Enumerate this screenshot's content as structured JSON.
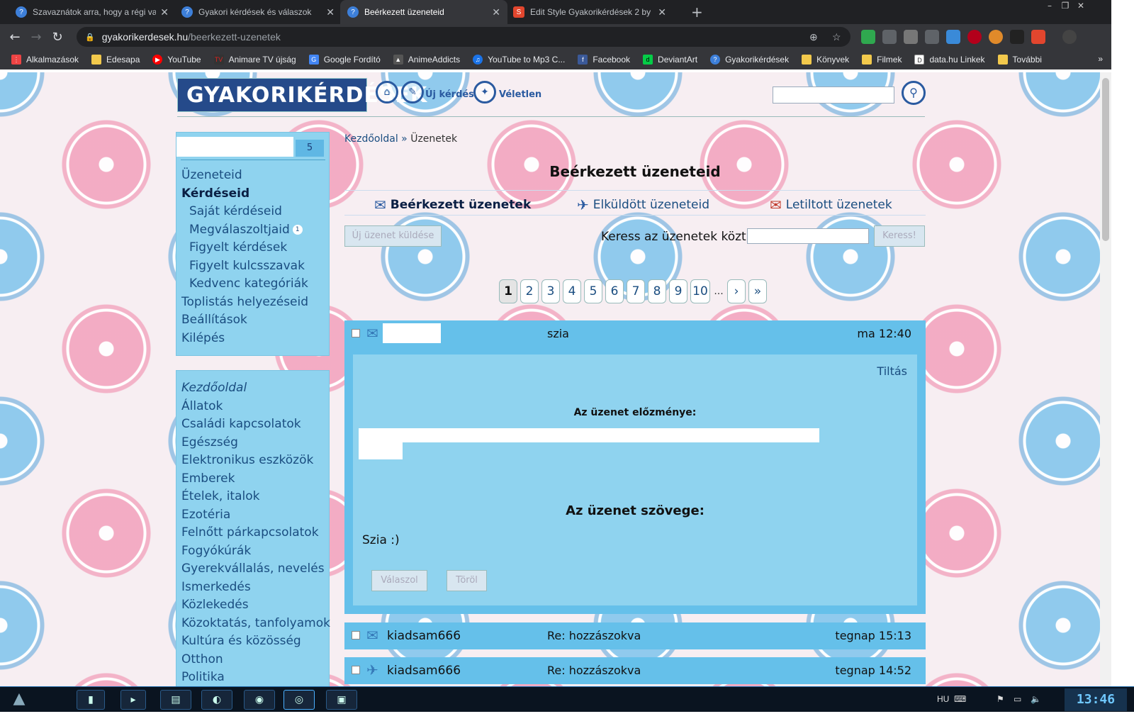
{
  "browser": {
    "tabs": [
      {
        "title": "Szavaznátok arra, hogy a régi va",
        "active": false
      },
      {
        "title": "Gyakori kérdések és válaszok",
        "active": false
      },
      {
        "title": "Beérkezett üzeneteid",
        "active": true
      },
      {
        "title": "Edit Style Gyakorikérdések 2 by",
        "active": false
      }
    ],
    "url_host": "gyakorikerdesek.hu",
    "url_path": "/beerkezett-uzenetek",
    "bookmarks": [
      "Alkalmazások",
      "Edesapa",
      "YouTube",
      "Animare TV újság",
      "Google Fordító",
      "AnimeAddicts",
      "YouTube to Mp3 C...",
      "Facebook",
      "DeviantArt",
      "Gyakorikérdések",
      "Könyvek",
      "Filmek",
      "data.hu Linkek",
      "További"
    ]
  },
  "site": {
    "logo": "GYAKORIKÉRDÉSEK",
    "new_question": "Új kérdés",
    "random": "Véletlen"
  },
  "sidebar": {
    "badge": "5",
    "menu": [
      {
        "label": "Üzeneteid",
        "style": ""
      },
      {
        "label": "Kérdéseid",
        "style": "bold"
      },
      {
        "label": "Saját kérdéseid",
        "style": "sub"
      },
      {
        "label": "Megválaszoltjaid",
        "style": "sub",
        "count": "1"
      },
      {
        "label": "Figyelt kérdések",
        "style": "sub"
      },
      {
        "label": "Figyelt kulcsszavak",
        "style": "sub"
      },
      {
        "label": "Kedvenc kategóriák",
        "style": "sub"
      },
      {
        "label": "Toplistás helyezéseid",
        "style": ""
      },
      {
        "label": "Beállítások",
        "style": ""
      },
      {
        "label": "Kilépés",
        "style": ""
      }
    ],
    "categories": [
      "Kezdőoldal",
      "Állatok",
      "Családi kapcsolatok",
      "Egészség",
      "Elektronikus eszközök",
      "Emberek",
      "Ételek, italok",
      "Ezotéria",
      "Felnőtt párkapcsolatok",
      "Fogyókúrák",
      "Gyerekvállalás, nevelés",
      "Ismerkedés",
      "Közlekedés",
      "Közoktatás, tanfolyamok",
      "Kultúra és közösség",
      "Otthon",
      "Politika"
    ]
  },
  "main": {
    "breadcrumb_home": "Kezdőoldal",
    "breadcrumb_sep": "»",
    "breadcrumb_current": "Üzenetek",
    "title": "Beérkezett üzeneteid",
    "tabs": [
      "Beérkezett üzenetek",
      "Elküldött üzeneteid",
      "Letiltott üzenetek"
    ],
    "new_message_btn": "Új üzenet küldése",
    "search_label": "Keress az üzenetek közt:",
    "search_btn": "Keress!",
    "pages": [
      "1",
      "2",
      "3",
      "4",
      "5",
      "6",
      "7",
      "8",
      "9",
      "10"
    ],
    "pages_dots": "...",
    "next": "›",
    "last": "»",
    "messages": [
      {
        "sender": "",
        "subject": "szia",
        "date": "ma 12:40",
        "expanded": true
      },
      {
        "sender": "kiadsam666",
        "subject": "Re: hozzászokva",
        "date": "tegnap 15:13",
        "expanded": false
      },
      {
        "sender": "kiadsam666",
        "subject": "Re: hozzászokva",
        "date": "tegnap 14:52",
        "expanded": false
      }
    ],
    "open_message": {
      "block": "Tiltás",
      "history_label": "Az üzenet előzménye:",
      "text_label": "Az üzenet szövege:",
      "text": "Szia :)",
      "reply_btn": "Válaszol",
      "delete_btn": "Töröl"
    }
  },
  "taskbar": {
    "lang": "HU",
    "clock": "13:46"
  }
}
